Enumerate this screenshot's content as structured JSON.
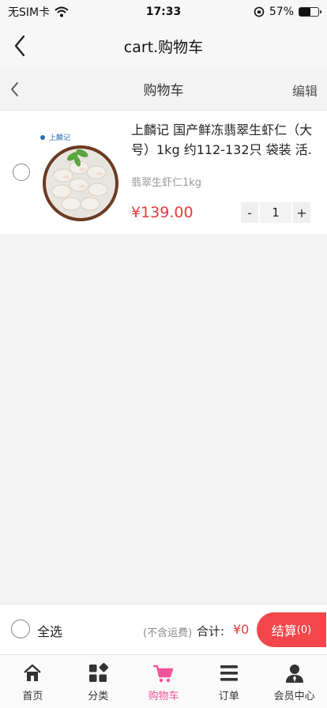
{
  "status_bar": {
    "carrier": "无SIM卡",
    "time": "17:33",
    "battery": "57%",
    "battery_level": 0.57
  },
  "nav": {
    "title": "cart.购物车"
  },
  "sub_header": {
    "title": "购物车",
    "edit": "编辑"
  },
  "cart_item": {
    "title": "上麟记 国产鲜冻翡翠生虾仁（大号）1kg 约112-132只 袋装 活.",
    "spec": "翡翠生虾仁1kg",
    "price": "¥139.00",
    "quantity": "1",
    "minus": "-",
    "plus": "+",
    "brand_logo": "上麟记"
  },
  "checkout": {
    "select_all": "全选",
    "shipping_note": "(不含运费)",
    "total_label": "合计:",
    "total_value": "¥0",
    "checkout_label": "结算",
    "checkout_count": "(0)"
  },
  "tabs": [
    {
      "label": "首页",
      "icon": "home-icon"
    },
    {
      "label": "分类",
      "icon": "category-icon"
    },
    {
      "label": "购物车",
      "icon": "cart-icon"
    },
    {
      "label": "订单",
      "icon": "list-icon"
    },
    {
      "label": "会员中心",
      "icon": "user-icon"
    }
  ],
  "colors": {
    "accent": "#f2464a",
    "price": "#e23b3b",
    "active_tab": "#f0539a"
  }
}
